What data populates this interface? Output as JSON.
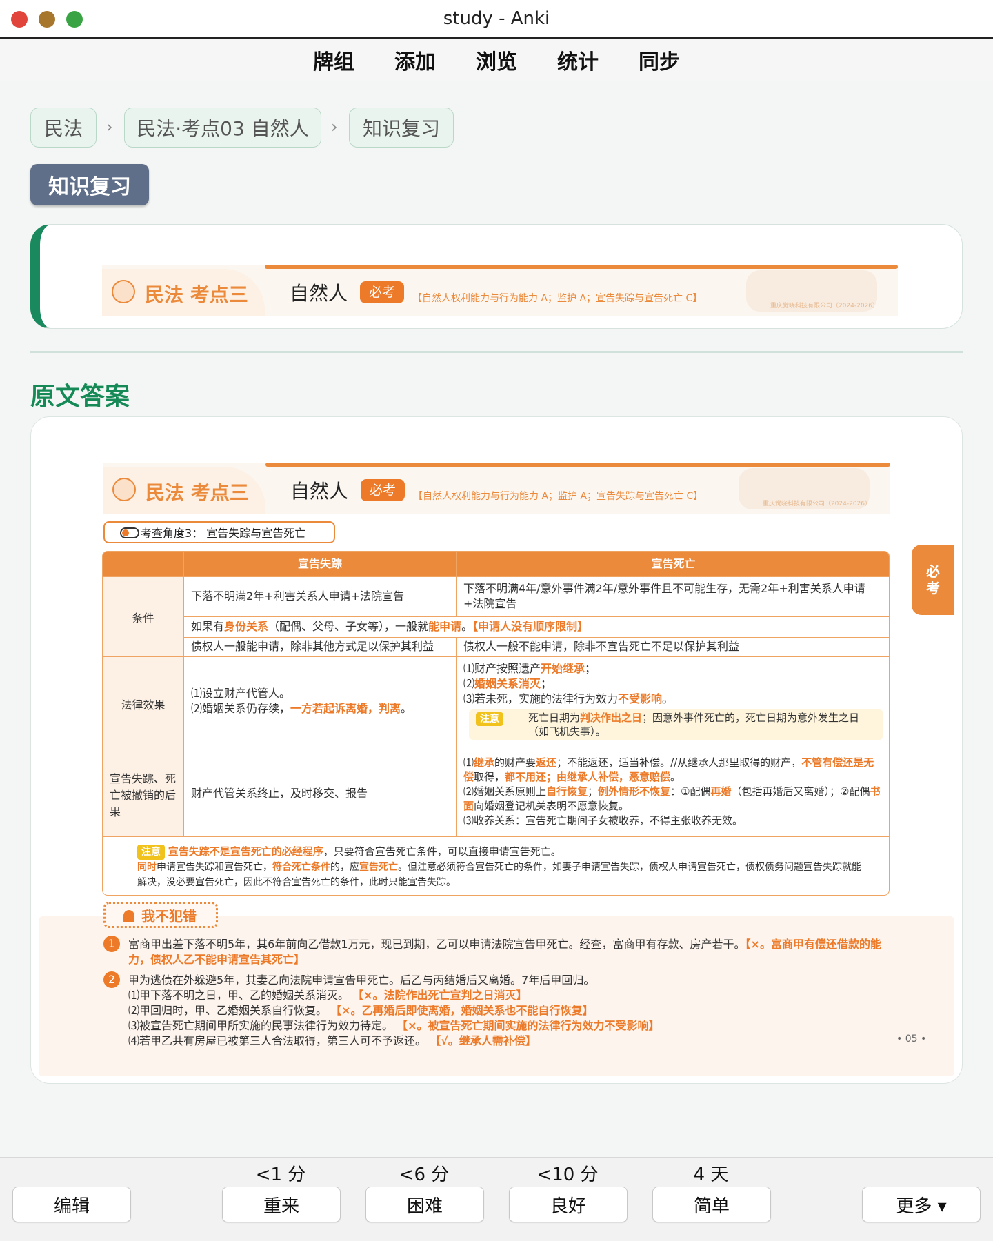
{
  "window": {
    "title": "study - Anki"
  },
  "toolbar": {
    "items": [
      "牌组",
      "添加",
      "浏览",
      "统计",
      "同步"
    ]
  },
  "breadcrumb": [
    "民法",
    "民法·考点03 自然人",
    "知识复习"
  ],
  "section_pill": "知识复习",
  "card_header": {
    "subject": "民法 考点三",
    "topic": "自然人",
    "must_badge": "必考",
    "scope": "【自然人权利能力与行为能力 A；监护 A；宣告失踪与宣告死亡 C】",
    "company": "重庆觉晓科技有限公司（2024-2026）"
  },
  "answer_heading": "原文答案",
  "angle_label": "考查角度3：  宣告失踪与宣告死亡",
  "side_tab": [
    "必",
    "考"
  ],
  "table": {
    "col1": "宣告失踪",
    "col2": "宣告死亡",
    "rows": {
      "cond_label": "条件",
      "cond_a1": "下落不明满2年+利害关系人申请+法院宣告",
      "cond_b1": "下落不明满4年/意外事件满2年/意外事件且不可能生存，无需2年+利害关系人申请+法院宣告",
      "cond_mid_1": "如果有",
      "cond_mid_2": "身份关系",
      "cond_mid_3": "（配偶、父母、子女等），一般就",
      "cond_mid_4": "能申请",
      "cond_mid_5": "。",
      "cond_mid_6": "【申请人没有顺序限制】",
      "cond_a3": "债权人一般能申请，除非其他方式足以保护其利益",
      "cond_b3": "债权人一般不能申请，除非不宣告死亡不足以保护其利益",
      "eff_label": "法律效果",
      "eff_a1": "⑴设立财产代管人。",
      "eff_a2": "⑵婚姻关系仍存续，",
      "eff_a3": "一方若起诉离婚，判离",
      "eff_a4": "。",
      "eff_b1a": "⑴财产按照遗产",
      "eff_b1b": "开始继承",
      "eff_b1c": "；",
      "eff_b2a": "⑵",
      "eff_b2b": "婚姻关系消灭",
      "eff_b2c": "；",
      "eff_b3a": "⑶若未死，实施的法律行为效力",
      "eff_b3b": "不受影响",
      "eff_b3c": "。",
      "note_word": "注意",
      "eff_note_a": "死亡日期为",
      "eff_note_b": "判决作出之日",
      "eff_note_c": "；因意外事件死亡的，死亡日期为意外发生之日（如飞机失事）。",
      "rev_label": "宣告失踪、死亡被撤销的后果",
      "rev_a": "财产代管关系终止，及时移交、报告",
      "rev_b1a": "⑴",
      "rev_b1b": "继承",
      "rev_b1c": "的财产要",
      "rev_b1d": "返还",
      "rev_b1e": "；不能返还，适当补偿。//从继承人那里取得的财产，",
      "rev_b1f": "不管有偿还是无偿",
      "rev_b1g": "取得，",
      "rev_b1h": "都不用还；由继承人补偿，恶意赔偿",
      "rev_b1i": "。",
      "rev_b2a": "⑵婚姻关系原则上",
      "rev_b2b": "自行恢复",
      "rev_b2c": "；",
      "rev_b2d": "例外情形不恢复",
      "rev_b2e": "：①配偶",
      "rev_b2f": "再婚",
      "rev_b2g": "（包括再婚后又离婚）；②配偶",
      "rev_b2h": "书面",
      "rev_b2i": "向婚姻登记机关表明不愿意恢复。",
      "rev_b3": "⑶收养关系：宣告死亡期间子女被收养，不得主张收养无效。",
      "foot1a": "宣告失踪不是宣告死亡的必经程序",
      "foot1b": "，只要符合宣告死亡条件，可以直接申请宣告死亡。",
      "foot2a": "同时",
      "foot2b": "申请宣告失踪和宣告死亡，",
      "foot2c": "符合死亡条件",
      "foot2d": "的，应",
      "foot2e": "宣告死亡",
      "foot2f": "。但注意必须符合宣告死亡的条件，如妻子申请宣告失踪，债权人申请宣告死亡，债权债务问题宣告失踪就能解决，没必要宣告死亡，因此不符合宣告死亡的条件，此时只能宣告失踪。"
    }
  },
  "mistakes": {
    "title": "我不犯错",
    "q1_num": "1",
    "q1_text": "富商甲出差下落不明5年，其6年前向乙借款1万元，现已到期，乙可以申请法院宣告甲死亡。经查，富商甲有存款、房产若干。",
    "q1_ans": "【×。富商甲有偿还借款的能力，债权人乙不能申请宣告其死亡】",
    "q2_num": "2",
    "q2_text": "甲为逃债在外躲避5年，其妻乙向法院申请宣告甲死亡。后乙与丙结婚后又离婚。7年后甲回归。",
    "q2_s1": "⑴甲下落不明之日，甲、乙的婚姻关系消灭。",
    "q2_s1a": "【×。法院作出死亡宣判之日消灭】",
    "q2_s2": "⑵甲回归时，甲、乙婚姻关系自行恢复。",
    "q2_s2a": "【×。乙再婚后即使离婚，婚姻关系也不能自行恢复】",
    "q2_s3": "⑶被宣告死亡期间甲所实施的民事法律行为效力待定。",
    "q2_s3a": "【×。被宣告死亡期间实施的法律行为效力不受影响】",
    "q2_s4": "⑷若甲乙共有房屋已被第三人合法取得，第三人可不予返还。",
    "q2_s4a": "【√。继承人需补偿】",
    "page": "• 05 •"
  },
  "answer_bar": {
    "edit": "编辑",
    "more": "更多 ▾",
    "buttons": [
      {
        "label": "重来",
        "eta": "<1 分"
      },
      {
        "label": "困难",
        "eta": "<6 分"
      },
      {
        "label": "良好",
        "eta": "<10 分"
      },
      {
        "label": "简单",
        "eta": "4 天"
      }
    ]
  },
  "colors": {
    "accent_green": "#1a8a5e",
    "accent_orange": "#ec8a3c",
    "pill": "#5f6f89"
  }
}
